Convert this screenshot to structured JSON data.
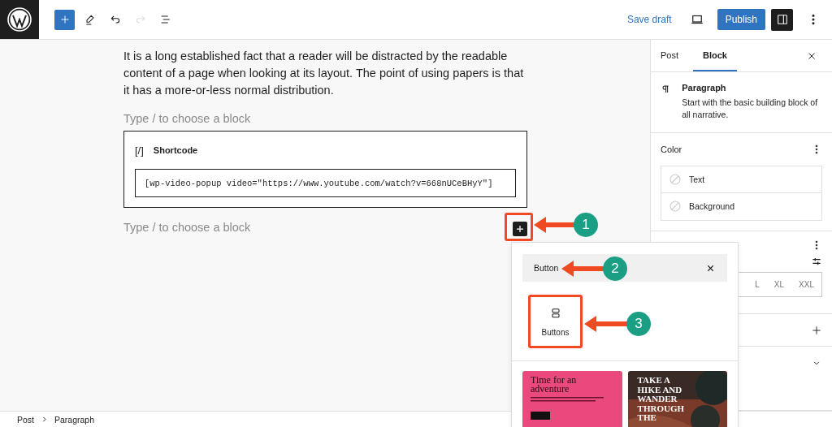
{
  "toolbar": {
    "tools": [
      {
        "kind": "add",
        "disabled": false
      },
      {
        "kind": "edit",
        "disabled": false
      },
      {
        "kind": "undo",
        "disabled": false
      },
      {
        "kind": "redo",
        "disabled": true
      },
      {
        "kind": "list",
        "disabled": false
      }
    ],
    "save_draft": "Save draft",
    "publish": "Publish",
    "settings_pressed": true
  },
  "editor": {
    "paragraph": "It is a long established fact that a reader will be distracted by the readable content of a page when looking at its layout. The point of using papers is that it has a more-or-less normal distribution.",
    "placeholders": [
      "Type / to choose a block",
      "Type / to choose a block"
    ],
    "shortcode": {
      "icon": "[/]",
      "title": "Shortcode",
      "value": "[wp-video-popup video=\"https://www.youtube.com/watch?v=668nUCeBHyY\"]"
    }
  },
  "sidebar": {
    "tabs": [
      {
        "label": "Post",
        "selected": false
      },
      {
        "label": "Block",
        "selected": true
      }
    ],
    "block": {
      "title": "Paragraph",
      "description": "Start with the basic building block of all narrative."
    },
    "color": {
      "title": "Color",
      "items": [
        "Text",
        "Background"
      ]
    },
    "sizes": [
      {
        "label": "L",
        "selected": false
      },
      {
        "label": "XL",
        "selected": false
      },
      {
        "label": "XXL",
        "selected": false
      }
    ]
  },
  "inserter": {
    "search_value": "Button",
    "results": [
      {
        "label": "Buttons",
        "highlighted": true
      }
    ],
    "patterns": [
      {
        "kind": "pink",
        "title": "Time for an adventure"
      },
      {
        "title": "TAKE A HIKE AND WANDER THROUGH THE"
      }
    ]
  },
  "annotations": [
    {
      "number": "1"
    },
    {
      "number": "2"
    },
    {
      "number": "3"
    }
  ],
  "breadcrumb": [
    "Post",
    "Paragraph"
  ]
}
